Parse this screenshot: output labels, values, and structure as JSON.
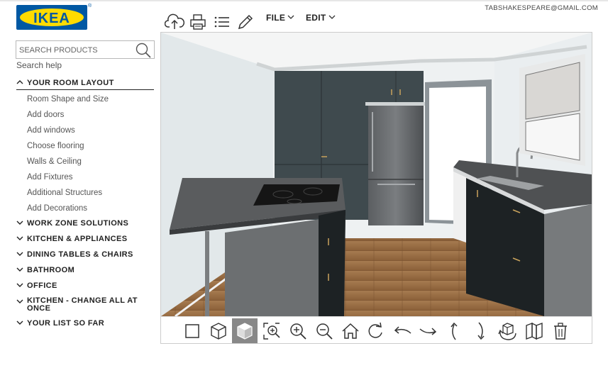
{
  "brand": {
    "logo_text": "IKEA",
    "color_blue": "#0058a3",
    "color_yellow": "#ffdb00"
  },
  "account": {
    "email": "TABSHAKESPEARE@GMAIL.COM"
  },
  "search": {
    "placeholder": "SEARCH PRODUCTS",
    "value": "",
    "help_link": "Search help"
  },
  "toolbar": {
    "icons": [
      "cloud-upload-icon",
      "print-icon",
      "list-icon",
      "pencil-icon"
    ],
    "menus": [
      {
        "label": "FILE"
      },
      {
        "label": "EDIT"
      }
    ]
  },
  "sidebar": {
    "open_section": {
      "label": "YOUR ROOM LAYOUT",
      "items": [
        "Room Shape and Size",
        "Add doors",
        "Add windows",
        "Choose flooring",
        "Walls & Ceiling",
        "Add Fixtures",
        "Additional Structures",
        "Add Decorations"
      ]
    },
    "sections": [
      "WORK ZONE SOLUTIONS",
      "KITCHEN & APPLIANCES",
      "DINING TABLES & CHAIRS",
      "BATHROOM",
      "OFFICE",
      "KITCHEN - CHANGE ALL AT ONCE",
      "YOUR LIST SO FAR"
    ]
  },
  "view_controls": {
    "buttons": [
      {
        "name": "view-2d-icon",
        "active": false
      },
      {
        "name": "view-3d-wireframe-icon",
        "active": false
      },
      {
        "name": "view-3d-solid-icon",
        "active": true
      },
      {
        "name": "zoom-to-fit-icon",
        "active": false
      },
      {
        "name": "zoom-in-icon",
        "active": false
      },
      {
        "name": "zoom-out-icon",
        "active": false
      },
      {
        "name": "home-icon",
        "active": false
      },
      {
        "name": "rotate-clockwise-icon",
        "active": false
      },
      {
        "name": "pan-left-icon",
        "active": false
      },
      {
        "name": "pan-right-icon",
        "active": false
      },
      {
        "name": "tilt-up-icon",
        "active": false
      },
      {
        "name": "tilt-down-icon",
        "active": false
      },
      {
        "name": "rotate-object-icon",
        "active": false
      },
      {
        "name": "catalog-view-icon",
        "active": false
      },
      {
        "name": "trash-icon",
        "active": false
      }
    ]
  },
  "scene": {
    "cabinet_color": "#3f4a4e",
    "countertop_color": "#5a5c5e",
    "floor_color": "#9c7046",
    "wall_color": "#e4e8ea"
  }
}
